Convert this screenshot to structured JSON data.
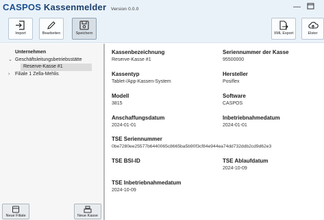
{
  "window": {
    "brand": "CASPOS",
    "name": "Kassenmelder",
    "version": "Version 0.0.0"
  },
  "toolbar": {
    "import_label": "Import",
    "edit_label": "Bearbeiten",
    "save_label": "Speichern",
    "xml_export_label": "XML Export",
    "elster_label": "Elster"
  },
  "sidebar": {
    "root": "Unternehmen",
    "items": [
      {
        "label": "Geschäftsleitungsbetriebsstätte",
        "expanded": true,
        "children": [
          "Reserve-Kasse #1"
        ]
      },
      {
        "label": "Filiale 1 Zella-Mehlis",
        "expanded": false
      }
    ],
    "new_branch_label": "Neue Filiale",
    "new_register_label": "Neue Kasse"
  },
  "details": {
    "kassenbezeichnung": {
      "label": "Kassenbezeichnung",
      "value": "Reserve-Kasse #1"
    },
    "seriennummer": {
      "label": "Seriennummer der Kasse",
      "value": "95500000"
    },
    "kassentyp": {
      "label": "Kassentyp",
      "value": "Tablet-/App-Kassen-System"
    },
    "hersteller": {
      "label": "Hersteller",
      "value": "Posiflex"
    },
    "modell": {
      "label": "Modell",
      "value": "3815"
    },
    "software": {
      "label": "Software",
      "value": "CASPOS"
    },
    "anschaffungsdatum": {
      "label": "Anschaffungsdatum",
      "value": "2024-01-01"
    },
    "inbetriebnahmedatum": {
      "label": "Inbetriebnahmedatum",
      "value": "2024-01-01"
    },
    "tse_seriennummer": {
      "label": "TSE Seriennummer",
      "value": "0be7280ee25577b6440065c8665ba5b90f3cf84e944ea74dd732ddb2cd9d62e3"
    },
    "tse_bsi_id": {
      "label": "TSE BSI-ID",
      "value": ""
    },
    "tse_ablaufdatum": {
      "label": "TSE Ablaufdatum",
      "value": "2024-10-09"
    },
    "tse_inbetriebnahmedatum": {
      "label": "TSE Inbetriebnahmedatum",
      "value": "2024-10-09"
    }
  },
  "colors": {
    "brand": "#1b4f8e",
    "chrome": "#eaf2f9",
    "selection": "#dcdcdc"
  }
}
